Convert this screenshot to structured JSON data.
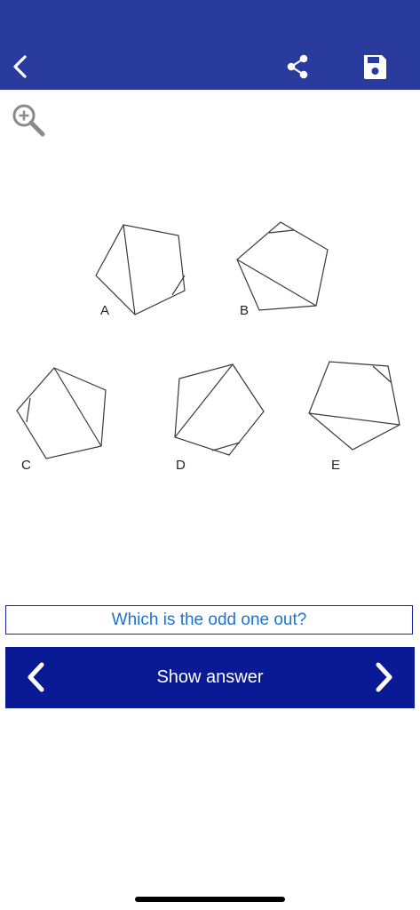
{
  "header": {
    "back_icon": "chevron-left-icon",
    "share_icon": "share-icon",
    "save_icon": "save-icon",
    "background_color": "#2a3b9e"
  },
  "toolbar": {
    "zoom_icon": "zoom-in-icon"
  },
  "puzzle": {
    "options": [
      {
        "label": "A"
      },
      {
        "label": "B"
      },
      {
        "label": "C"
      },
      {
        "label": "D"
      },
      {
        "label": "E"
      }
    ]
  },
  "question": {
    "text": "Which is the odd one out?",
    "text_color": "#1a73d8"
  },
  "navigation": {
    "show_answer_label": "Show answer",
    "prev_icon": "chevron-left-icon",
    "next_icon": "chevron-right-icon",
    "background_color": "#0a1a94"
  }
}
